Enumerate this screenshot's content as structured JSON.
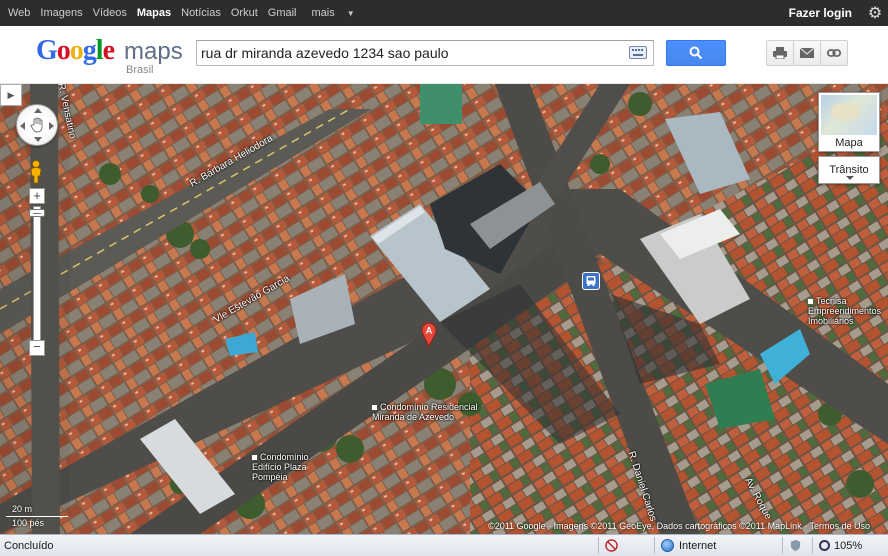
{
  "topbar": {
    "nav": [
      {
        "label": "Web",
        "active": false
      },
      {
        "label": "Imagens",
        "active": false
      },
      {
        "label": "Vídeos",
        "active": false
      },
      {
        "label": "Mapas",
        "active": true
      },
      {
        "label": "Notícias",
        "active": false
      },
      {
        "label": "Orkut",
        "active": false
      },
      {
        "label": "Gmail",
        "active": false
      },
      {
        "label": "mais",
        "active": false
      }
    ],
    "login": "Fazer login",
    "settings_icon": "gear-icon"
  },
  "header": {
    "logo_google": [
      "G",
      "o",
      "o",
      "g",
      "l",
      "e"
    ],
    "logo_maps": "maps",
    "logo_region": "Brasil",
    "search_value": "rua dr miranda azevedo 1234 sao paulo",
    "colors": {
      "search_button": "#4d90fe",
      "bar_bg": "#2d2d2d"
    }
  },
  "map": {
    "map_type_label": "Mapa",
    "traffic_label": "Trânsito",
    "marker_label": "A",
    "streets": [
      {
        "text": "R. Vensatino"
      },
      {
        "text": "R. Bárbara Heliodora"
      },
      {
        "text": "Vle Estevão Garcia"
      },
      {
        "text": "R. Daniel Carlos"
      },
      {
        "text": "Av. Roque"
      }
    ],
    "pois": [
      {
        "text": "Condomínio Residencial Miranda de Azevedo"
      },
      {
        "text": "Condomínio Edifício Plaza Pompéia"
      },
      {
        "text": "Tecnisa Empreendimentos Imobiliários"
      }
    ],
    "scale": {
      "metric": "20 m",
      "imperial": "100 pés"
    },
    "copyright": "©2011 Google - Imagens ©2011 GeoEye, Dados cartográficos ©2011 MapLink - Termos de Uso"
  },
  "statusbar": {
    "status": "Concluído",
    "zone": "Internet",
    "zoom": "105%"
  }
}
